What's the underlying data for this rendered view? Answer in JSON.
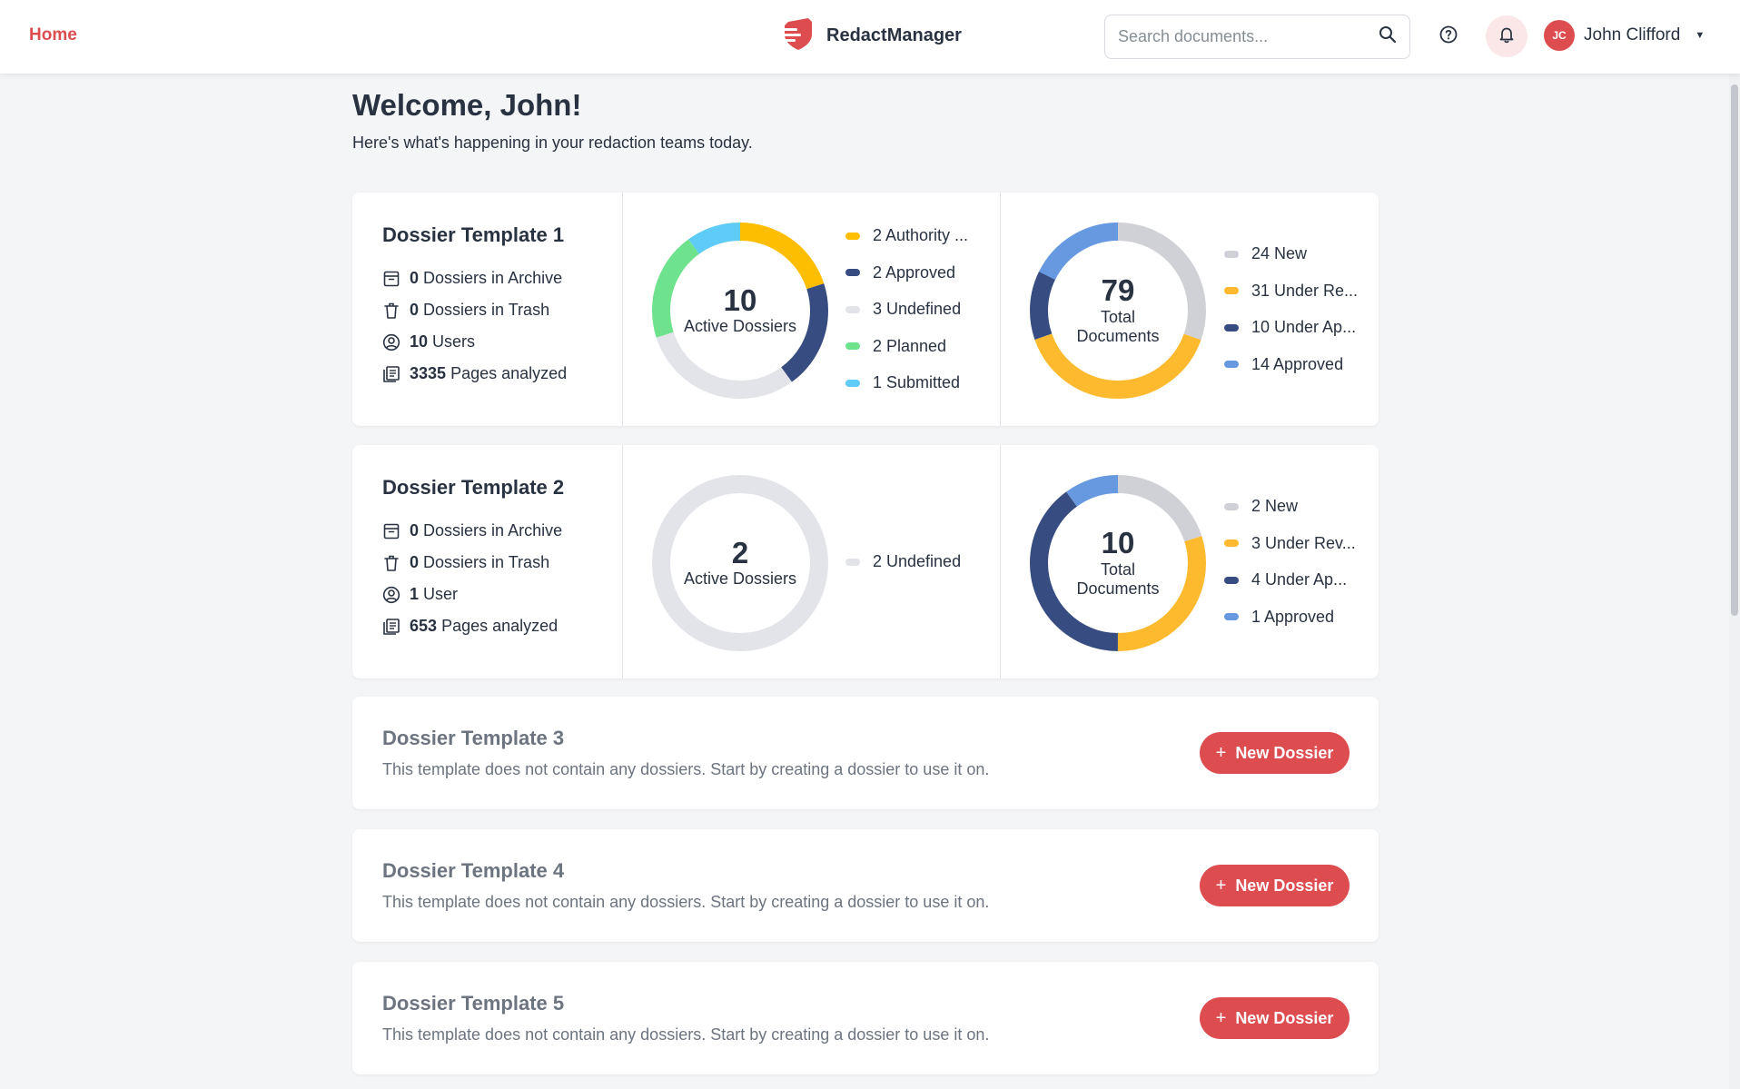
{
  "header": {
    "home_label": "Home",
    "brand_name": "RedactManager",
    "search_placeholder": "Search documents...",
    "user_initials": "JC",
    "user_name": "John Clifford",
    "accent_color": "#dd4d50"
  },
  "welcome": {
    "title": "Welcome, John!",
    "subtitle": "Here's what's happening in your redaction teams today."
  },
  "templates": [
    {
      "title": "Dossier Template 1",
      "archive_count": "0",
      "archive_label": "Dossiers in Archive",
      "trash_count": "0",
      "trash_label": "Dossiers in Trash",
      "users_count": "10",
      "users_label": "Users",
      "pages_count": "3335",
      "pages_label": "Pages analyzed",
      "dossiers_total": "10",
      "dossiers_label": "Active Dossiers",
      "dossiers_legend": [
        {
          "label": "2 Authority ...",
          "value": 2,
          "color": "#fdbd00"
        },
        {
          "label": "2 Approved",
          "value": 2,
          "color": "#374c81"
        },
        {
          "label": "3 Undefined",
          "value": 3,
          "color": "#e2e4e9"
        },
        {
          "label": "2 Planned",
          "value": 2,
          "color": "#6ee28d"
        },
        {
          "label": "1 Submitted",
          "value": 1,
          "color": "#5fcbf7"
        }
      ],
      "docs_total": "79",
      "docs_label": "Total Documents",
      "docs_legend": [
        {
          "label": "24 New",
          "value": 24,
          "color": "#d0d1d7"
        },
        {
          "label": "31 Under Re...",
          "value": 31,
          "color": "#fdba2e"
        },
        {
          "label": "10 Under Ap...",
          "value": 10,
          "color": "#374c81"
        },
        {
          "label": "14 Approved",
          "value": 14,
          "color": "#6799e0"
        }
      ]
    },
    {
      "title": "Dossier Template 2",
      "archive_count": "0",
      "archive_label": "Dossiers in Archive",
      "trash_count": "0",
      "trash_label": "Dossiers in Trash",
      "users_count": "1",
      "users_label": "User",
      "pages_count": "653",
      "pages_label": "Pages analyzed",
      "dossiers_total": "2",
      "dossiers_label": "Active Dossiers",
      "dossiers_legend": [
        {
          "label": "2 Undefined",
          "value": 2,
          "color": "#e2e4e9"
        }
      ],
      "docs_total": "10",
      "docs_label": "Total Documents",
      "docs_legend": [
        {
          "label": "2 New",
          "value": 2,
          "color": "#d0d1d7"
        },
        {
          "label": "3 Under Rev...",
          "value": 3,
          "color": "#fdba2e"
        },
        {
          "label": "4 Under Ap...",
          "value": 4,
          "color": "#374c81"
        },
        {
          "label": "1 Approved",
          "value": 1,
          "color": "#6799e0"
        }
      ]
    }
  ],
  "empty_templates": [
    {
      "title": "Dossier Template 3",
      "text": "This template does not contain any dossiers. Start by creating a dossier to use it on.",
      "button_label": "New Dossier"
    },
    {
      "title": "Dossier Template 4",
      "text": "This template does not contain any dossiers. Start by creating a dossier to use it on.",
      "button_label": "New Dossier"
    },
    {
      "title": "Dossier Template 5",
      "text": "This template does not contain any dossiers. Start by creating a dossier to use it on.",
      "button_label": "New Dossier"
    }
  ]
}
